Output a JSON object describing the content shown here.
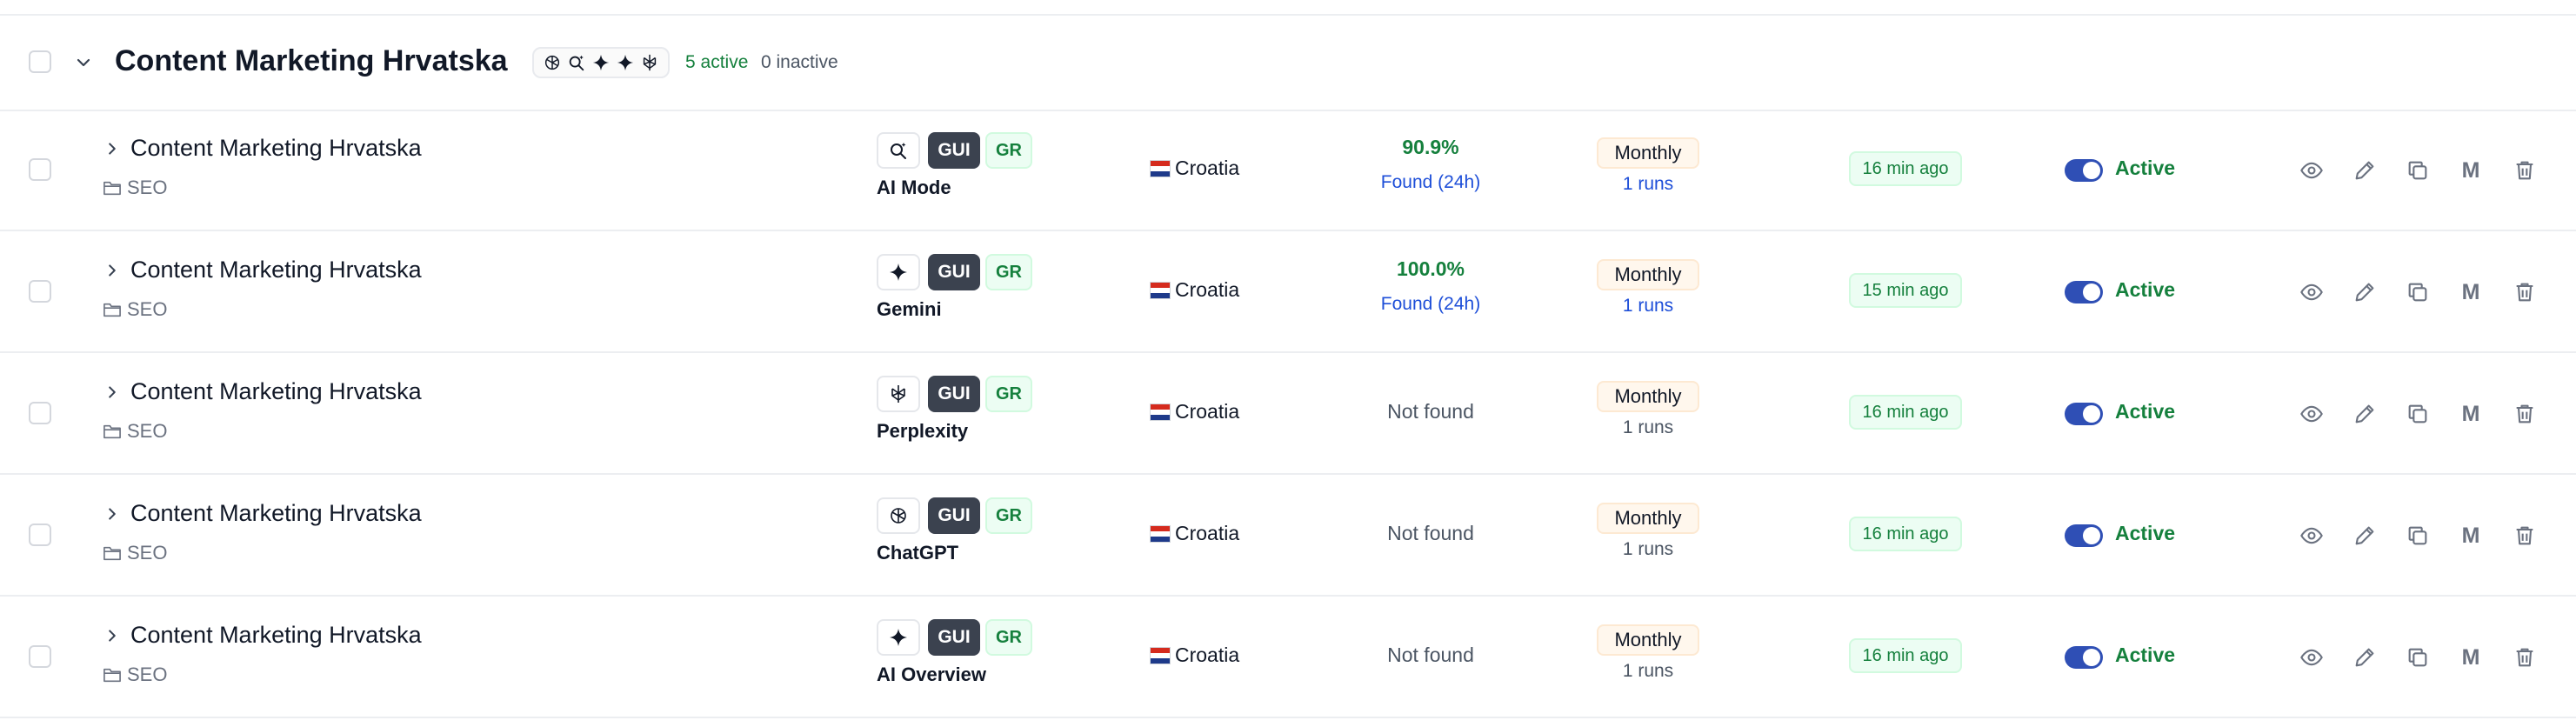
{
  "group": {
    "title": "Content Marketing Hrvatska",
    "active_count": "5 active",
    "inactive_count": "0 inactive",
    "engine_icons": [
      "chatgpt-icon",
      "ai-mode-icon",
      "sparkle-icon",
      "sparkle-icon",
      "perplexity-icon"
    ]
  },
  "rows": [
    {
      "title": "Content Marketing Hrvatska",
      "folder": "SEO",
      "engine_icon": "ai-mode-icon",
      "gui": "GUI",
      "gr": "GR",
      "engine": "AI Mode",
      "country": "Croatia",
      "visibility": "90.9%",
      "found": "Found (24h)",
      "frequency": "Monthly",
      "runs": "1 runs",
      "last_run": "16 min ago",
      "status": "Active",
      "m_label": "M"
    },
    {
      "title": "Content Marketing Hrvatska",
      "folder": "SEO",
      "engine_icon": "sparkle-icon",
      "gui": "GUI",
      "gr": "GR",
      "engine": "Gemini",
      "country": "Croatia",
      "visibility": "100.0%",
      "found": "Found (24h)",
      "frequency": "Monthly",
      "runs": "1 runs",
      "last_run": "15 min ago",
      "status": "Active",
      "m_label": "M"
    },
    {
      "title": "Content Marketing Hrvatska",
      "folder": "SEO",
      "engine_icon": "perplexity-icon",
      "gui": "GUI",
      "gr": "GR",
      "engine": "Perplexity",
      "country": "Croatia",
      "visibility": "Not found",
      "found": "",
      "frequency": "Monthly",
      "runs": "1 runs",
      "last_run": "16 min ago",
      "status": "Active",
      "m_label": "M"
    },
    {
      "title": "Content Marketing Hrvatska",
      "folder": "SEO",
      "engine_icon": "chatgpt-icon",
      "gui": "GUI",
      "gr": "GR",
      "engine": "ChatGPT",
      "country": "Croatia",
      "visibility": "Not found",
      "found": "",
      "frequency": "Monthly",
      "runs": "1 runs",
      "last_run": "16 min ago",
      "status": "Active",
      "m_label": "M"
    },
    {
      "title": "Content Marketing Hrvatska",
      "folder": "SEO",
      "engine_icon": "sparkle-icon",
      "gui": "GUI",
      "gr": "GR",
      "engine": "AI Overview",
      "country": "Croatia",
      "visibility": "Not found",
      "found": "",
      "frequency": "Monthly",
      "runs": "1 runs",
      "last_run": "16 min ago",
      "status": "Active",
      "m_label": "M"
    }
  ],
  "colors": {
    "accent_green": "#15803d",
    "link_blue": "#1d4ed8",
    "toggle_blue": "#2f4fb5",
    "gui_badge": "#3b424f"
  }
}
